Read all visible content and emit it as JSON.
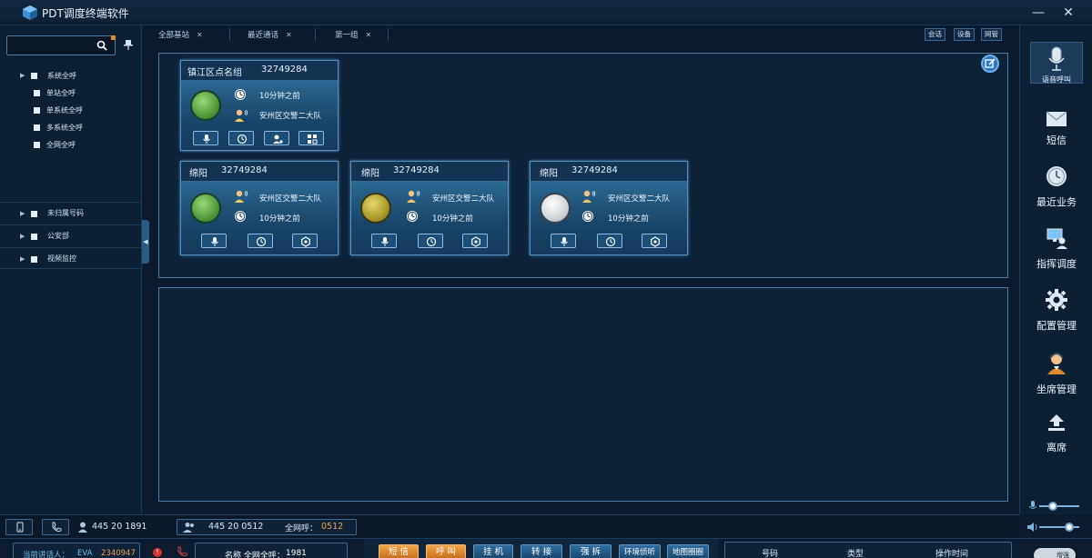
{
  "app": {
    "title": "PDT调度终端软件"
  },
  "window": {
    "min_icon": "minimize-icon",
    "close_icon": "close-icon"
  },
  "left": {
    "search": {
      "value": "",
      "placeholder": ""
    },
    "tree": [
      {
        "label": "系统全呼",
        "level": 1,
        "expanded": true
      },
      {
        "label": "单站全呼",
        "level": 2
      },
      {
        "label": "单系统全呼",
        "level": 2
      },
      {
        "label": "多系统全呼",
        "level": 2
      },
      {
        "label": "全网全呼",
        "level": 2
      }
    ],
    "sections": [
      {
        "label": "未归属号码"
      },
      {
        "label": "公安部"
      },
      {
        "label": "视频监控"
      }
    ]
  },
  "tabs": [
    {
      "label": "全部基站"
    },
    {
      "label": "最近通话"
    },
    {
      "label": "第一组"
    }
  ],
  "mini_tabs": [
    "会话",
    "设备",
    "网管"
  ],
  "cards": [
    {
      "name": "镇江区点名组",
      "number": "32749284",
      "status": "green",
      "line1": "10分钟之前",
      "line2": "安州区交警二大队"
    },
    {
      "name": "绵阳",
      "number": "32749284",
      "status": "green",
      "line1": "安州区交警二大队",
      "line2": "10分钟之前"
    },
    {
      "name": "绵阳",
      "number": "32749284",
      "status": "yellow",
      "line1": "安州区交警二大队",
      "line2": "10分钟之前"
    },
    {
      "name": "绵阳",
      "number": "32749284",
      "status": "gray",
      "line1": "安州区交警二大队",
      "line2": "10分钟之前"
    }
  ],
  "right_bar": [
    {
      "label": "语音呼叫",
      "icon": "microphone-icon"
    },
    {
      "label": "短信",
      "icon": "envelope-icon"
    },
    {
      "label": "最近业务",
      "icon": "clock-icon"
    },
    {
      "label": "指挥调度",
      "icon": "dispatch-icon"
    },
    {
      "label": "配置管理",
      "icon": "gear-icon"
    },
    {
      "label": "坐席管理",
      "icon": "operator-icon"
    },
    {
      "label": "离席",
      "icon": "upload-icon"
    }
  ],
  "volume": {
    "mic_level": 0.35,
    "speaker_level": 0.75
  },
  "status1": {
    "user_number": "445 20 1891",
    "group_number": "445 20 0512",
    "all_call_label": "全网呼：",
    "all_call_value": "0512"
  },
  "status2": {
    "current_speaker_label": "当前讲话人：",
    "current_speaker_value": "EVA",
    "current_speaker_number": "2340947",
    "name_label": "名称 全网全呼：",
    "name_value": "1981",
    "buttons": [
      {
        "label": "短 信",
        "style": "orange"
      },
      {
        "label": "呼 叫",
        "style": "orange"
      },
      {
        "label": "挂 机",
        "style": "blue"
      },
      {
        "label": "转 接",
        "style": "blue"
      },
      {
        "label": "强 拆",
        "style": "blue"
      },
      {
        "label": "环境侦听",
        "style": "blue"
      },
      {
        "label": "地图圈圈",
        "style": "blue"
      }
    ],
    "table_headers": [
      "号码",
      "类型",
      "操作时间"
    ],
    "toggle_label": "增强"
  },
  "colors": {
    "accent": "#2c78c0",
    "orange": "#e08a2c",
    "bg": "#0b1a2c"
  }
}
